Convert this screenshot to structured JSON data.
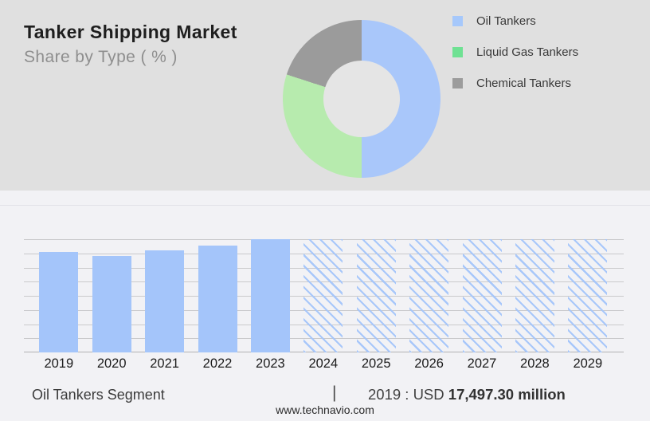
{
  "header": {
    "title": "Tanker Shipping Market",
    "subtitle": "Share by Type ( % )"
  },
  "colors": {
    "header_background": "#e0e0e0",
    "body_background": "#f2f2f5",
    "bar_blue": "#a4c5fa",
    "gridline": "#c9c9cb",
    "axis": "#b2b2b4",
    "donut_hole": "#e5e5e5"
  },
  "chart_data": [
    {
      "type": "pie",
      "donut": true,
      "title": "Share by Type ( % )",
      "legend_position": "right",
      "segments": [
        {
          "label": "Oil Tankers",
          "value": 50,
          "color": "#a9c7fa",
          "legend_color": "#a6c8fb"
        },
        {
          "label": "Liquid Gas Tankers",
          "value": 30,
          "color": "#b7ebae",
          "legend_color": "#6fe193"
        },
        {
          "label": "Chemical Tankers",
          "value": 20,
          "color": "#9b9b9b",
          "legend_color": "#9c9c9c"
        }
      ]
    },
    {
      "type": "bar",
      "unit": "USD million",
      "categories": [
        "2019",
        "2020",
        "2021",
        "2022",
        "2023",
        "2024",
        "2025",
        "2026",
        "2027",
        "2028",
        "2029"
      ],
      "values": [
        17497.3,
        16840,
        17740,
        18570,
        19720,
        19720,
        19720,
        19720,
        19720,
        19720,
        19720
      ],
      "forecast_start_index": 5,
      "ylim": [
        0,
        19720
      ],
      "gridline_count": 8,
      "grid": true,
      "xlabel": "",
      "ylabel": ""
    }
  ],
  "footer": {
    "segment_label": "Oil Tankers Segment",
    "divider_glyph": "|",
    "value_prefix": "2019 : USD ",
    "value_amount": "17,497.30 million",
    "website": "www.technavio.com"
  }
}
